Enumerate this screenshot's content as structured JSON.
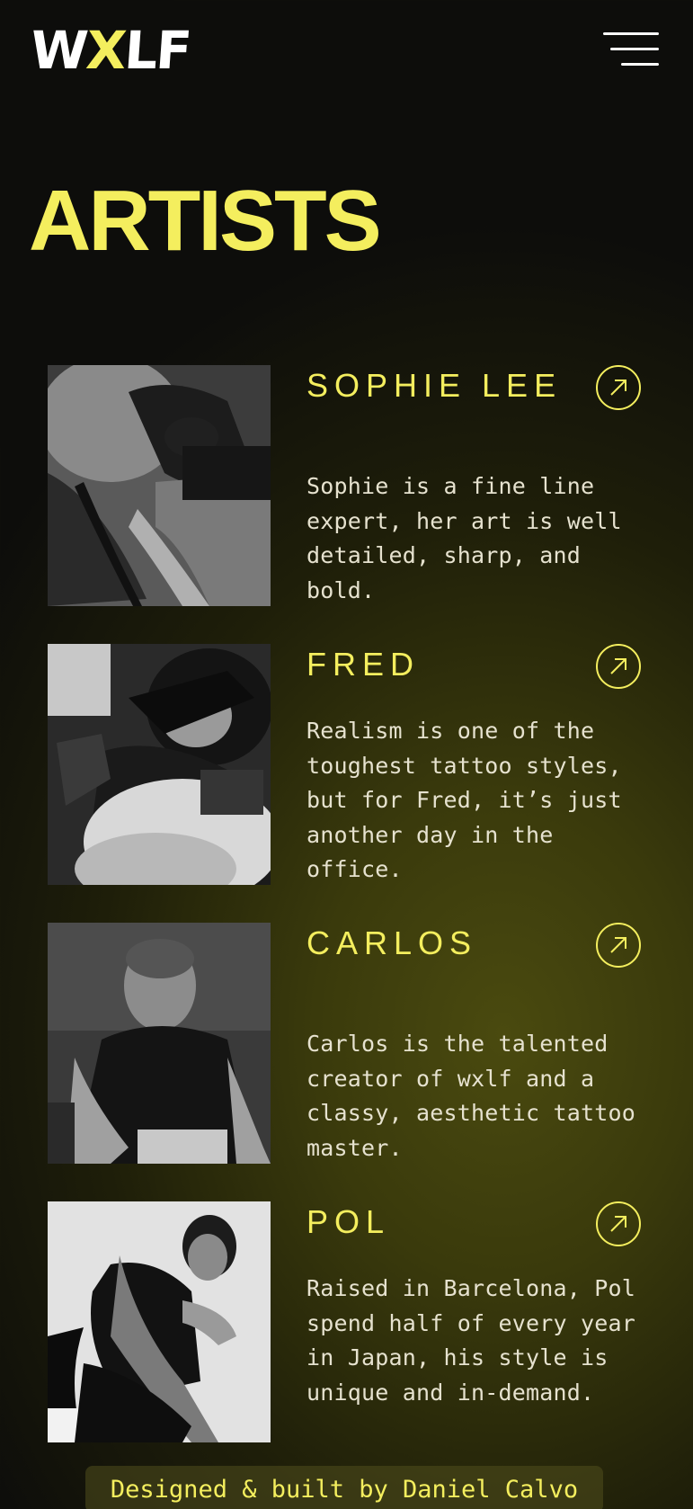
{
  "header": {
    "logo_part1": "W",
    "logo_part2": "X",
    "logo_part3": "LF",
    "accent_color": "#f4ee5e"
  },
  "page": {
    "title": "ARTISTS"
  },
  "artists": [
    {
      "name": "SOPHIE LEE",
      "bio": "Sophie is a fine line expert, her art is well detailed, sharp, and bold."
    },
    {
      "name": "FRED",
      "bio": "Realism is one of the toughest tattoo styles, but for Fred, it’s just another day in the office."
    },
    {
      "name": "CARLOS",
      "bio": "Carlos is the talented creator of wxlf and a classy, aesthetic tattoo master."
    },
    {
      "name": "POL",
      "bio": "Raised in Barcelona, Pol spend half of every year in Japan, his style is unique and in-demand."
    }
  ],
  "footer": {
    "credit": "Designed & built by Daniel Calvo"
  }
}
